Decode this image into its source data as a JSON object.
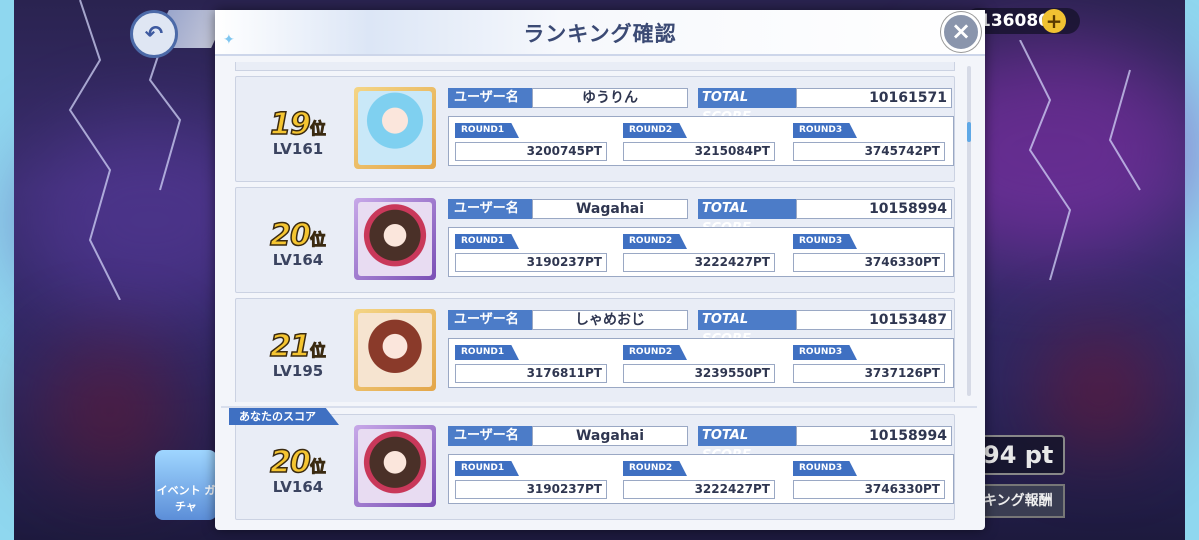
{
  "hud": {
    "currency": "136080",
    "plus": "+",
    "pt": "94 pt",
    "reward": "キング報酬",
    "gacha": "イベント ガチャ"
  },
  "modal": {
    "title": "ランキング確認",
    "close": "×"
  },
  "labels": {
    "username": "ユーザー名",
    "total_score": "TOTAL SCORE",
    "round1": "ROUND1",
    "round2": "ROUND2",
    "round3": "ROUND3",
    "rank_suffix": "位",
    "my_score": "あなたのスコア"
  },
  "rows": [
    {
      "rank": "19",
      "level": "LV161",
      "name": "ゆうりん",
      "total": "10161571",
      "r1": "3200745PT",
      "r2": "3215084PT",
      "r3": "3745742PT",
      "avatar": "blue-hair-character"
    },
    {
      "rank": "20",
      "level": "LV164",
      "name": "Wagahai",
      "total": "10158994",
      "r1": "3190237PT",
      "r2": "3222427PT",
      "r3": "3746330PT",
      "avatar": "dark-hair-character"
    },
    {
      "rank": "21",
      "level": "LV195",
      "name": "しゃめおじ",
      "total": "10153487",
      "r1": "3176811PT",
      "r2": "3239550PT",
      "r3": "3737126PT",
      "avatar": "red-hair-character"
    }
  ],
  "my_row": {
    "rank": "20",
    "level": "LV164",
    "name": "Wagahai",
    "total": "10158994",
    "r1": "3190237PT",
    "r2": "3222427PT",
    "r3": "3746330PT",
    "avatar": "dark-hair-character"
  }
}
